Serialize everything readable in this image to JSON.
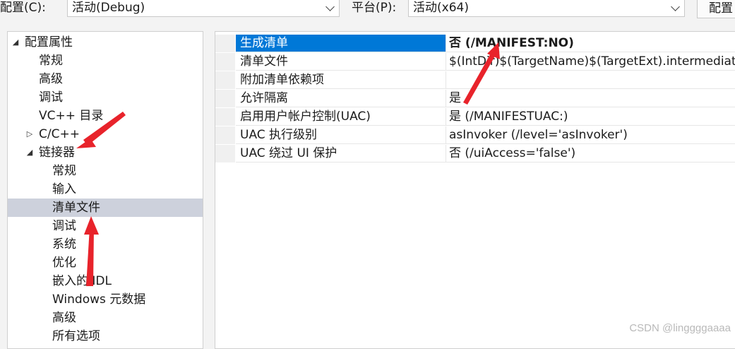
{
  "toolbar": {
    "config_label": "配置(C):",
    "config_value": "活动(Debug)",
    "platform_label": "平台(P):",
    "platform_value": "活动(x64)",
    "config_manager_button": "配置"
  },
  "tree": {
    "items": [
      {
        "label": "配置属性",
        "toggle": "◢"
      },
      {
        "label": "常规"
      },
      {
        "label": "高级"
      },
      {
        "label": "调试"
      },
      {
        "label": "VC++ 目录"
      },
      {
        "label": "C/C++",
        "toggle": "▷"
      },
      {
        "label": "链接器",
        "toggle": "◢"
      },
      {
        "label": "常规"
      },
      {
        "label": "输入"
      },
      {
        "label": "清单文件",
        "selected": true
      },
      {
        "label": "调试"
      },
      {
        "label": "系统"
      },
      {
        "label": "优化"
      },
      {
        "label": "嵌入的 IDL"
      },
      {
        "label": "Windows 元数据"
      },
      {
        "label": "高级"
      },
      {
        "label": "所有选项"
      }
    ]
  },
  "properties": {
    "rows": [
      {
        "name": "生成清单",
        "value": "否 (/MANIFEST:NO)",
        "selected": true
      },
      {
        "name": "清单文件",
        "value": "$(IntDir)$(TargetName)$(TargetExt).intermediate.manifest"
      },
      {
        "name": "附加清单依赖项",
        "value": ""
      },
      {
        "name": "允许隔离",
        "value": "是"
      },
      {
        "name": "启用用户帐户控制(UAC)",
        "value": "是 (/MANIFESTUAC:)"
      },
      {
        "name": "UAC 执行级别",
        "value": "asInvoker (/level='asInvoker')"
      },
      {
        "name": "UAC 绕过 UI 保护",
        "value": "否 (/uiAccess='false')"
      }
    ]
  },
  "watermark": "CSDN @linggggaaaa",
  "annotation_color": "#e8232b"
}
